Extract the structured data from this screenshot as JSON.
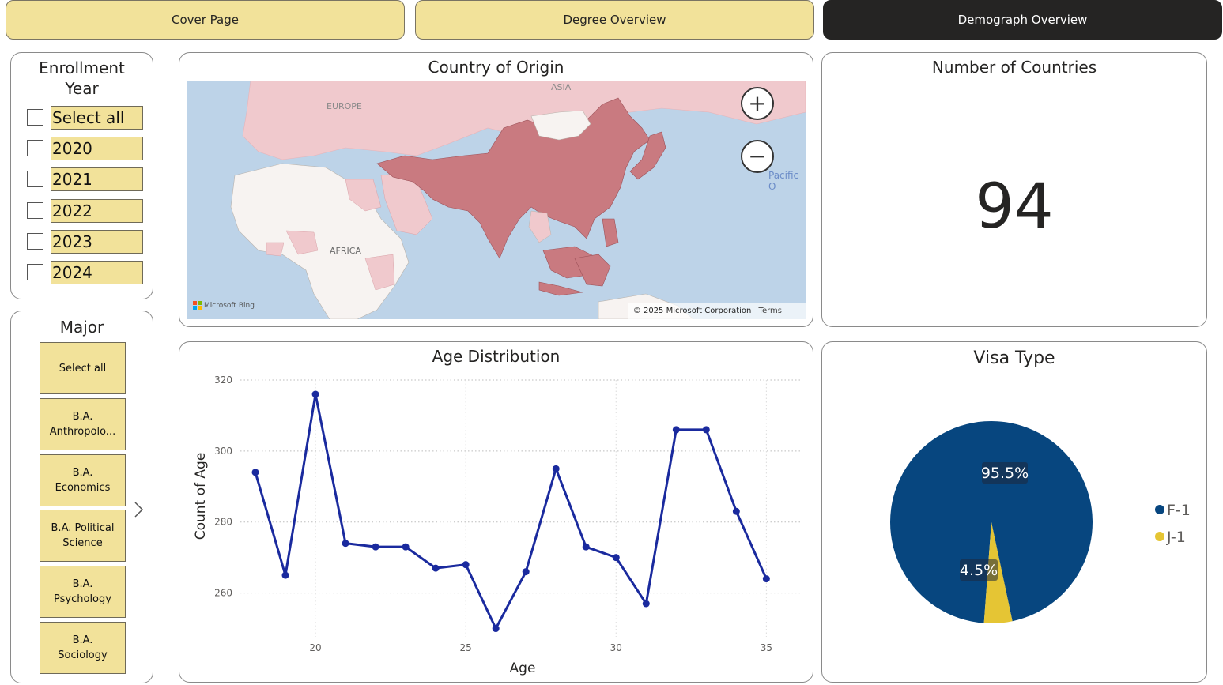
{
  "nav": {
    "cover": "Cover Page",
    "degree": "Degree Overview",
    "demograph": "Demograph Overview"
  },
  "enrollment": {
    "title_line1": "Enrollment",
    "title_line2": "Year",
    "items": [
      "Select all",
      "2020",
      "2021",
      "2022",
      "2023",
      "2024"
    ]
  },
  "major": {
    "title": "Major",
    "items": [
      {
        "line1": "Select all",
        "line2": ""
      },
      {
        "line1": "B.A.",
        "line2": "Anthropolo..."
      },
      {
        "line1": "B.A.",
        "line2": "Economics"
      },
      {
        "line1": "B.A. Political",
        "line2": "Science"
      },
      {
        "line1": "B.A.",
        "line2": "Psychology"
      },
      {
        "line1": "B.A.",
        "line2": "Sociology"
      }
    ],
    "next_icon": "chevron-right-icon"
  },
  "map": {
    "title": "Country of Origin",
    "labels": {
      "europe": "EUROPE",
      "asia": "ASIA",
      "africa": "AFRICA",
      "pacific": "Pacific O"
    },
    "attribution": "Microsoft Bing",
    "copyright": "© 2025 Microsoft Corporation",
    "terms": "Terms",
    "zoom_in": "+",
    "zoom_out": "−"
  },
  "kpi": {
    "title": "Number of Countries",
    "value": "94"
  },
  "age": {
    "title": "Age Distribution"
  },
  "visa": {
    "title": "Visa Type"
  },
  "colors": {
    "accent_yellow": "#f2e29a",
    "line": "#1a2a9e",
    "f1": "#07467f",
    "j1": "#e5c534",
    "map_highlight": "#c97a80",
    "map_light": "#f0c9cd",
    "ocean": "#bdd3e8"
  },
  "chart_data": [
    {
      "type": "line",
      "title": "Age Distribution",
      "xlabel": "Age",
      "ylabel": "Count of Age",
      "x": [
        18,
        19,
        20,
        21,
        22,
        23,
        24,
        25,
        26,
        27,
        28,
        29,
        30,
        31,
        32,
        33,
        34,
        35
      ],
      "values": [
        294,
        265,
        316,
        274,
        273,
        273,
        267,
        268,
        250,
        266,
        295,
        273,
        270,
        257,
        306,
        306,
        283,
        264
      ],
      "xticks": [
        20,
        25,
        30,
        35
      ],
      "yticks": [
        260,
        280,
        300,
        320
      ],
      "xlim": [
        17.5,
        36.2
      ],
      "ylim": [
        249,
        320
      ],
      "grid": true
    },
    {
      "type": "pie",
      "title": "Visa Type",
      "categories": [
        "F-1",
        "J-1"
      ],
      "values": [
        95.5,
        4.5
      ],
      "labels": [
        "95.5%",
        "4.5%"
      ],
      "legend": "right"
    }
  ]
}
